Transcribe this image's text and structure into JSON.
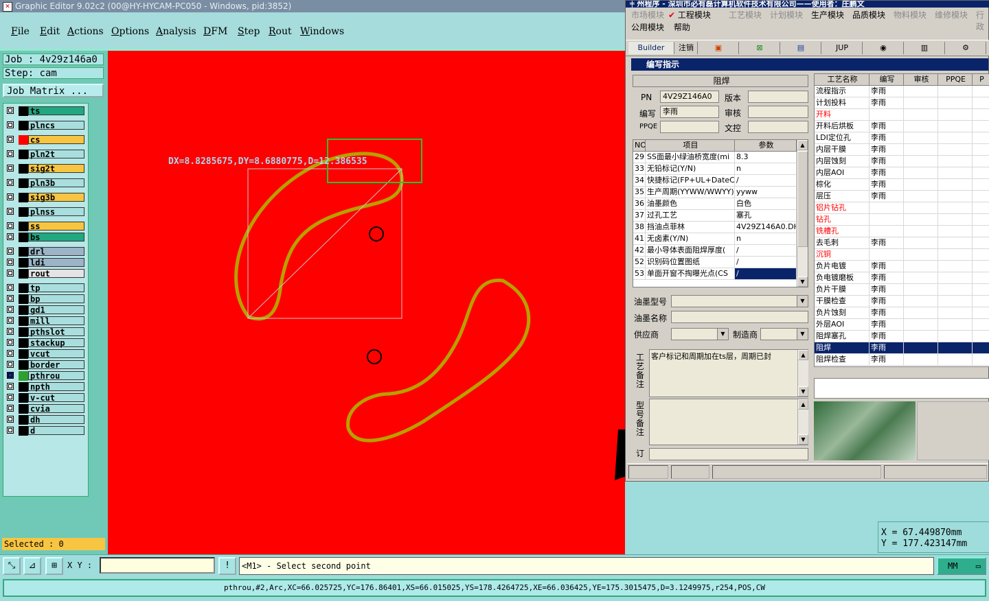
{
  "title_bar": {
    "text": "Graphic Editor 9.02c2 (00@HY-HYCAM-PC050 - Windows, pid:3852)"
  },
  "menu": [
    "File",
    "Edit",
    "Actions",
    "Options",
    "Analysis",
    "DFM",
    "Step",
    "Rout",
    "Windows"
  ],
  "job": {
    "job_label": "Job : 4v29z146a0",
    "step_label": "Step: cam",
    "matrix_button": "Job Matrix ..."
  },
  "layers": [
    {
      "name": "ts",
      "color": "#21a880",
      "swatch": "#000000"
    },
    {
      "name": "plncs",
      "color": "#a9dede",
      "swatch": "#000000"
    },
    {
      "name": "cs",
      "color": "#f7c542",
      "swatch": "#ff0000"
    },
    {
      "name": "pln2t",
      "color": "#a9dede",
      "swatch": "#000000"
    },
    {
      "name": "sig2t",
      "color": "#f7c542",
      "swatch": "#000000"
    },
    {
      "name": "pln3b",
      "color": "#a9dede",
      "swatch": "#000000"
    },
    {
      "name": "sig3b",
      "color": "#f7c542",
      "swatch": "#000000"
    },
    {
      "name": "plnss",
      "color": "#a9dede",
      "swatch": "#000000"
    },
    {
      "name": "ss",
      "color": "#f7c542",
      "swatch": "#000000"
    },
    {
      "name": "bs",
      "color": "#21a880",
      "swatch": "#000000"
    },
    {
      "name": "drl",
      "color": "#9bb4c8",
      "swatch": "#000000"
    },
    {
      "name": "ldi",
      "color": "#9bb4c8",
      "swatch": "#000000"
    },
    {
      "name": "rout",
      "color": "#e4e4e4",
      "swatch": "#000000"
    },
    {
      "name": "tp",
      "color": "#a9dede",
      "swatch": "#000000"
    },
    {
      "name": "bp",
      "color": "#a9dede",
      "swatch": "#000000"
    },
    {
      "name": "gd1",
      "color": "#a9dede",
      "swatch": "#000000"
    },
    {
      "name": "mill",
      "color": "#a9dede",
      "swatch": "#000000"
    },
    {
      "name": "pthslot",
      "color": "#a9dede",
      "swatch": "#000000"
    },
    {
      "name": "stackup",
      "color": "#a9dede",
      "swatch": "#000000"
    },
    {
      "name": "vcut",
      "color": "#a9dede",
      "swatch": "#000000"
    },
    {
      "name": "border",
      "color": "#a9dede",
      "swatch": "#000000"
    },
    {
      "name": "pthrou",
      "color": "#a9dede",
      "swatch": "#2fa02f"
    },
    {
      "name": "npth",
      "color": "#a9dede",
      "swatch": "#000000"
    },
    {
      "name": "v-cut",
      "color": "#a9dede",
      "swatch": "#000000"
    },
    {
      "name": "cvia",
      "color": "#a9dede",
      "swatch": "#000000"
    },
    {
      "name": "dh",
      "color": "#a9dede",
      "swatch": "#000000"
    },
    {
      "name": "d",
      "color": "#a9dede",
      "swatch": "#000000"
    }
  ],
  "selected_label": "Selected : 0",
  "canvas": {
    "measure_text": "DX=8.8285675,DY=8.6880775,D=12.386535",
    "background": "#ff0000",
    "outline_color": "#b8a000"
  },
  "command": {
    "xy_label": "X Y :",
    "xy_value": "",
    "prompt": "<M1> - Select second point",
    "units": "MM",
    "info_button": "!"
  },
  "status_bar": "pthrou,#2,Arc,XC=66.025725,YC=176.86401,XS=66.015025,YS=178.4264725,XE=66.036425,YE=175.3015475,D=3.1249975,r254,POS,CW",
  "coords": {
    "x_label": "X = 67.449870mm",
    "y_label": "Y = 177.423147mm"
  },
  "window": {
    "title": "╪ 州程序 - 深圳市必有磊计算机软件技术有限公司——使用者：庄鹏文",
    "modules_row1": [
      "市场模块",
      "工程模块",
      "工艺模块",
      "计划模块",
      "生产模块",
      "品质模块",
      "物料模块",
      "维修模块",
      "行政"
    ],
    "modules_row2": [
      "公用模块",
      "帮助"
    ],
    "tabs": [
      "Builder",
      "注销",
      "",
      "",
      "",
      "JUP",
      "",
      "",
      ""
    ],
    "subtitle": "编写指示",
    "section_title": "阻焊",
    "pn_label": "PN",
    "pn_value": "4V29Z146A0",
    "version_label": "版本",
    "version_value": "",
    "writer_label": "编写",
    "writer_value": "李雨",
    "review_label": "审核",
    "review_value": "",
    "ppqe_label": "PPQE",
    "ppqe_value": "",
    "doc_label": "文控",
    "doc_value": "",
    "param_headers": [
      "NO",
      "项目",
      "参数"
    ],
    "params": [
      [
        "29",
        "SS面最小绿油桥宽度(mi",
        "8.3"
      ],
      [
        "33",
        "无铅标记(Y/N)",
        "n"
      ],
      [
        "34",
        "快捷标记(FP+UL+DateCo",
        "/"
      ],
      [
        "35",
        "生产周期(YYWW/WWYY)",
        "yyww"
      ],
      [
        "36",
        "油墨颜色",
        "白色"
      ],
      [
        "37",
        "过孔工艺",
        "塞孔"
      ],
      [
        "38",
        "挡油点菲林",
        "4V29Z146A0.DH"
      ],
      [
        "41",
        "无卤素(Y/N)",
        "n"
      ],
      [
        "42",
        "最小导体表面阻焊厚度(",
        "/"
      ],
      [
        "52",
        "识别码位置图纸",
        "/"
      ],
      [
        "53",
        "单面开窗不掏曝光点(CS",
        "/"
      ]
    ],
    "ink_model_label": "油墨型号",
    "ink_name_label": "油墨名称",
    "supplier_label": "供应商",
    "maker_label": "制造商",
    "process_note_label": "工艺备注",
    "process_note_value": "客户标记和周期加在ts层，周期已封",
    "model_note_label": "型号备注",
    "order_label": "订",
    "process_headers": [
      "工艺名称",
      "编写",
      "审核",
      "PPQE",
      "P"
    ],
    "processes": [
      {
        "name": "流程指示",
        "writer": "李雨",
        "red": false
      },
      {
        "name": "计划投料",
        "writer": "李雨",
        "red": false
      },
      {
        "name": "开料",
        "writer": "",
        "red": true
      },
      {
        "name": "开料后烘板",
        "writer": "李雨",
        "red": false
      },
      {
        "name": "LDI定位孔",
        "writer": "李雨",
        "red": false
      },
      {
        "name": "内层干膜",
        "writer": "李雨",
        "red": false
      },
      {
        "name": "内层蚀刻",
        "writer": "李雨",
        "red": false
      },
      {
        "name": "内层AOI",
        "writer": "李雨",
        "red": false
      },
      {
        "name": "棕化",
        "writer": "李雨",
        "red": false
      },
      {
        "name": "层压",
        "writer": "李雨",
        "red": false
      },
      {
        "name": "铝片钻孔",
        "writer": "",
        "red": true
      },
      {
        "name": "钻孔",
        "writer": "",
        "red": true
      },
      {
        "name": "铣槽孔",
        "writer": "",
        "red": true
      },
      {
        "name": "去毛刺",
        "writer": "李雨",
        "red": false
      },
      {
        "name": "沉铜",
        "writer": "",
        "red": true
      },
      {
        "name": "负片电镀",
        "writer": "李雨",
        "red": false
      },
      {
        "name": "负电镀磨板",
        "writer": "李雨",
        "red": false
      },
      {
        "name": "负片干膜",
        "writer": "李雨",
        "red": false
      },
      {
        "name": "干膜检查",
        "writer": "李雨",
        "red": false
      },
      {
        "name": "负片蚀刻",
        "writer": "李雨",
        "red": false
      },
      {
        "name": "外层AOI",
        "writer": "李雨",
        "red": false
      },
      {
        "name": "阻焊塞孔",
        "writer": "李雨",
        "red": false
      },
      {
        "name": "阻焊",
        "writer": "李雨",
        "red": false,
        "selected": true
      },
      {
        "name": "阻焊检查",
        "writer": "李雨",
        "red": false
      }
    ]
  }
}
